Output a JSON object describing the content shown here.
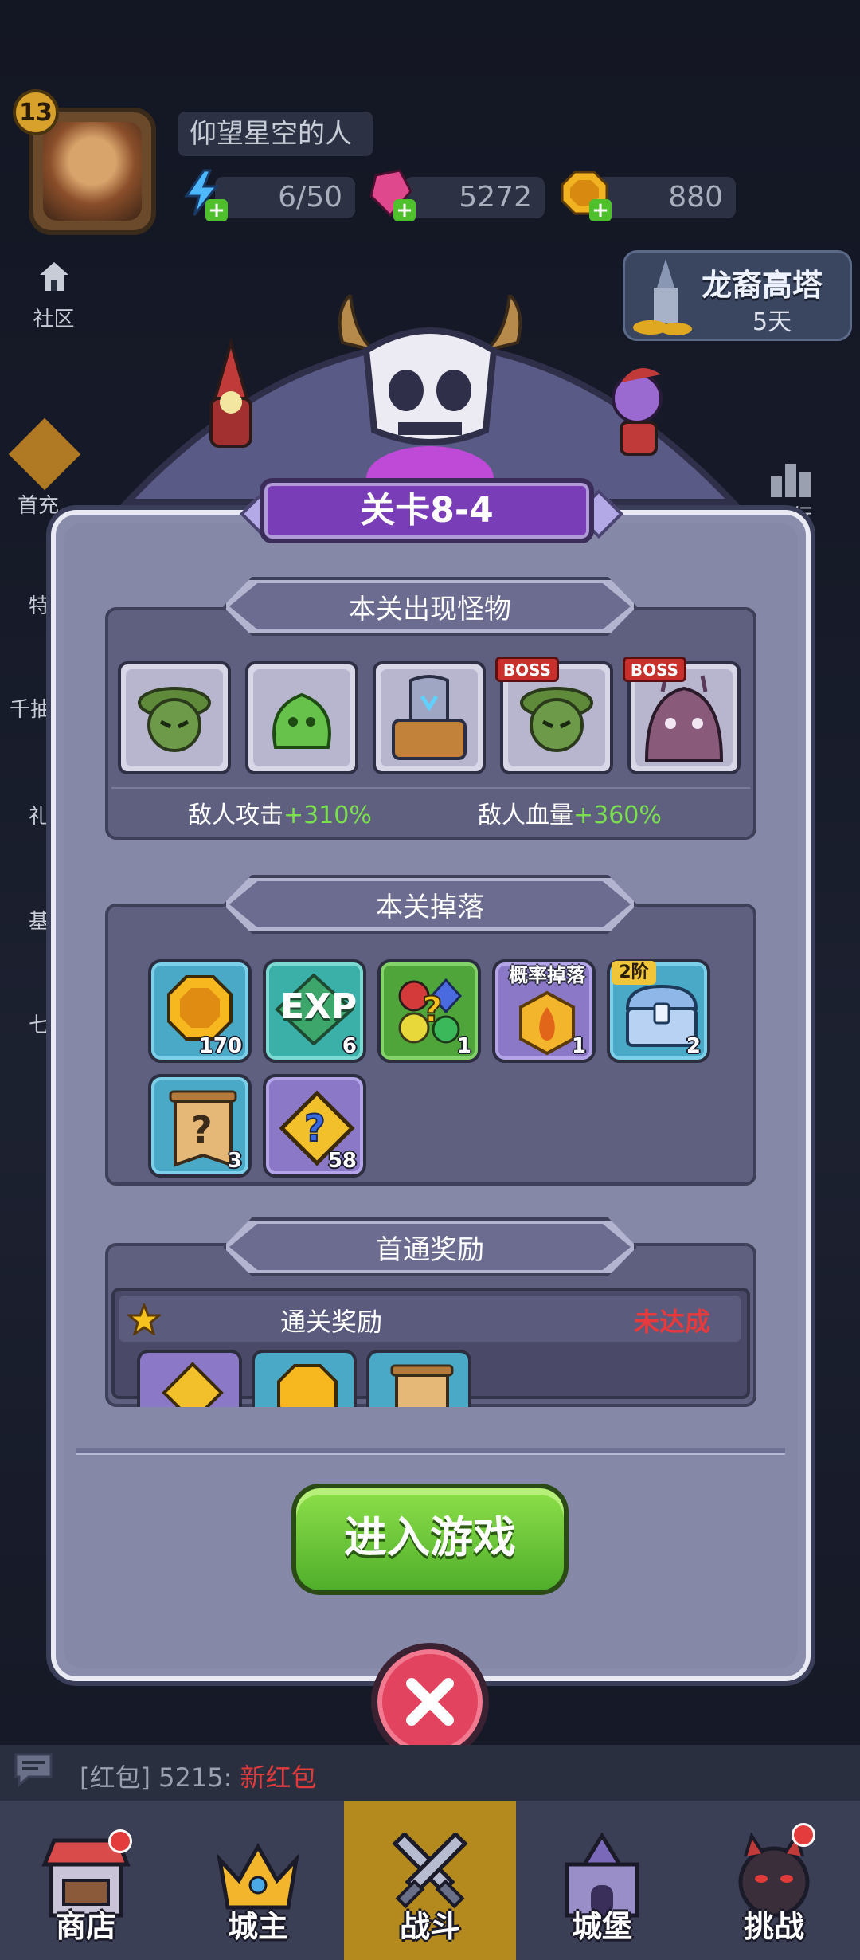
{
  "player": {
    "level": "13",
    "name": "仰望星空的人"
  },
  "resources": [
    {
      "name": "energy",
      "value": "6/50",
      "icon": "lightning-icon",
      "color": "#4db8ff"
    },
    {
      "name": "gems",
      "value": "5272",
      "icon": "gem-icon",
      "color": "#e0488e"
    },
    {
      "name": "coins",
      "value": "880",
      "icon": "coin-icon",
      "color": "#f1b322"
    }
  ],
  "community": {
    "label": "社区"
  },
  "event": {
    "title": "龙裔高塔",
    "days": "5天"
  },
  "side_left": [
    "首充",
    "特",
    "千抽",
    "礼",
    "基",
    "七"
  ],
  "side_right": [
    "排行"
  ],
  "stage": {
    "title": "关卡8-4"
  },
  "monsters": {
    "title": "本关出现怪物",
    "list": [
      {
        "name": "green-goblin",
        "boss": ""
      },
      {
        "name": "green-slime",
        "boss": ""
      },
      {
        "name": "armored-knight",
        "boss": ""
      },
      {
        "name": "green-goblin-boss",
        "boss": "BOSS"
      },
      {
        "name": "purple-beast-boss",
        "boss": "BOSS"
      }
    ],
    "attack_label": "敌人攻击",
    "attack_value": "+310%",
    "hp_label": "敌人血量",
    "hp_value": "+360%"
  },
  "drops": {
    "title": "本关掉落",
    "items": [
      {
        "name": "gold-coin",
        "count": "170",
        "tag": ""
      },
      {
        "name": "exp",
        "label": "EXP",
        "count": "6",
        "tag": ""
      },
      {
        "name": "random-gems",
        "count": "1",
        "tag": ""
      },
      {
        "name": "fire-badge",
        "count": "1",
        "tag": "概率掉落"
      },
      {
        "name": "treasure-chest",
        "count": "2",
        "tag": "2阶"
      },
      {
        "name": "mystery-scroll",
        "count": "3",
        "tag": ""
      },
      {
        "name": "mystery-puzzle",
        "count": "58",
        "tag": ""
      }
    ]
  },
  "first_clear": {
    "title": "首通奖励",
    "row_label": "通关奖励",
    "status": "未达成"
  },
  "enter_button": "进入游戏",
  "chat": {
    "prefix": "[红包]",
    "user": "5215:",
    "message": "新红包"
  },
  "nav": [
    {
      "label": "商店",
      "icon": "shop-icon",
      "badge": true
    },
    {
      "label": "城主",
      "icon": "crown-icon",
      "badge": false
    },
    {
      "label": "战斗",
      "icon": "swords-icon",
      "badge": false,
      "active": true
    },
    {
      "label": "城堡",
      "icon": "castle-icon",
      "badge": false
    },
    {
      "label": "挑战",
      "icon": "demon-icon",
      "badge": true
    }
  ]
}
